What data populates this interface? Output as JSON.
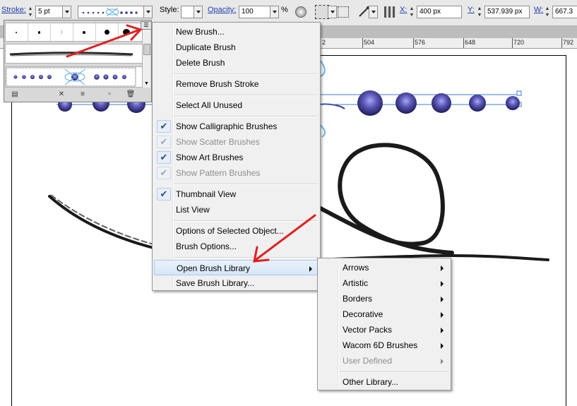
{
  "control_bar": {
    "stroke_label": "Stroke:",
    "stroke_weight": "5 pt",
    "style_label": "Style:",
    "opacity_label": "Opacity:",
    "opacity_value": "100",
    "opacity_unit": "%",
    "x_label": "X:",
    "x_value": "400 px",
    "y_label": "Y:",
    "y_value": "537.939 px",
    "w_label": "W:",
    "w_value": "667.3"
  },
  "ruler": {
    "labels": [
      "2",
      "504",
      "576",
      "648",
      "720",
      "792"
    ]
  },
  "brush_panel": {
    "menu_icon": "panel-menu-icon",
    "tools": [
      "brush-libraries-icon",
      "remove-stroke-icon",
      "options-icon",
      "new-brush-icon",
      "delete-icon"
    ]
  },
  "context_menu": {
    "items": [
      {
        "label": "New Brush...",
        "enabled": true,
        "checked": false
      },
      {
        "label": "Duplicate Brush",
        "enabled": true,
        "checked": false
      },
      {
        "label": "Delete Brush",
        "enabled": true,
        "checked": false
      },
      {
        "label": "Remove Brush Stroke",
        "enabled": true,
        "checked": false
      },
      {
        "label": "Select All Unused",
        "enabled": true,
        "checked": false
      },
      {
        "label": "Show Calligraphic Brushes",
        "enabled": true,
        "checked": true
      },
      {
        "label": "Show Scatter Brushes",
        "enabled": false,
        "checked": true
      },
      {
        "label": "Show Art Brushes",
        "enabled": true,
        "checked": true
      },
      {
        "label": "Show Pattern Brushes",
        "enabled": false,
        "checked": true
      },
      {
        "label": "Thumbnail View",
        "enabled": true,
        "checked": true
      },
      {
        "label": "List View",
        "enabled": true,
        "checked": false
      },
      {
        "label": "Options of Selected Object...",
        "enabled": true,
        "checked": false
      },
      {
        "label": "Brush Options...",
        "enabled": true,
        "checked": false
      },
      {
        "label": "Open Brush Library",
        "enabled": true,
        "checked": false,
        "submenu": true,
        "highlighted": true
      },
      {
        "label": "Save Brush Library...",
        "enabled": true,
        "checked": false
      }
    ]
  },
  "submenu": {
    "items": [
      {
        "label": "Arrows",
        "enabled": true
      },
      {
        "label": "Artistic",
        "enabled": true
      },
      {
        "label": "Borders",
        "enabled": true
      },
      {
        "label": "Decorative",
        "enabled": true
      },
      {
        "label": "Vector Packs",
        "enabled": true
      },
      {
        "label": "Wacom 6D Brushes",
        "enabled": true
      },
      {
        "label": "User Defined",
        "enabled": false
      },
      {
        "label": "Other Library...",
        "enabled": true
      }
    ]
  },
  "colors": {
    "annotation_arrow": "#e02020",
    "check_mark": "#2a4f8a",
    "bead_dark": "#2b2a6e",
    "bead_light": "#8b88d8",
    "selection": "#3a7bd5"
  }
}
